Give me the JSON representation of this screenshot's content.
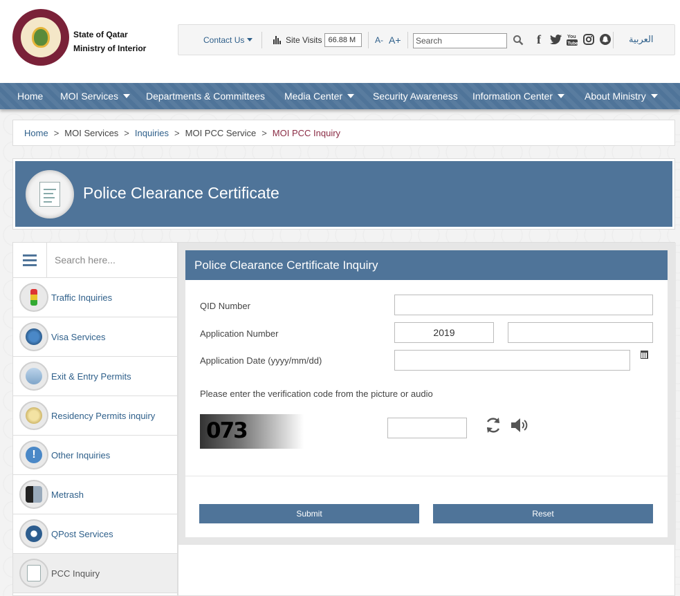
{
  "org": {
    "line1": "State of Qatar",
    "line2": "Ministry of Interior"
  },
  "topbar": {
    "contact_label": "Contact Us",
    "site_visits_label": "Site Visits",
    "site_visits_value": "66.88 M",
    "font_smaller": "A-",
    "font_larger": "A+",
    "search_placeholder": "Search",
    "social_icons": [
      "facebook-icon",
      "twitter-icon",
      "youtube-icon",
      "instagram-icon",
      "snapchat-icon"
    ],
    "language": "العربية"
  },
  "nav": {
    "items": [
      {
        "label": "Home"
      },
      {
        "label": "MOI Services"
      },
      {
        "label": "Departments & Committees"
      },
      {
        "label": "Media Center"
      },
      {
        "label": "Security Awareness"
      },
      {
        "label": "Information Center"
      },
      {
        "label": "About Ministry"
      }
    ]
  },
  "breadcrumb": {
    "items": [
      "Home",
      "MOI Services",
      "Inquiries",
      "MOI PCC Service",
      "MOI PCC Inquiry"
    ],
    "separator": ">"
  },
  "banner": {
    "title": "Police Clearance Certificate"
  },
  "sidebar": {
    "search_placeholder": "Search here...",
    "items": [
      {
        "label": "Traffic Inquiries"
      },
      {
        "label": "Visa Services"
      },
      {
        "label": "Exit & Entry Permits"
      },
      {
        "label": "Residency Permits inquiry"
      },
      {
        "label": "Other Inquiries"
      },
      {
        "label": "Metrash"
      },
      {
        "label": "QPost Services"
      },
      {
        "label": "PCC Inquiry"
      }
    ]
  },
  "form": {
    "title": "Police Clearance Certificate Inquiry",
    "qid_label": "QID Number",
    "qid_value": "",
    "app_number_label": "Application Number",
    "app_year_value": "2019",
    "app_number_value": "",
    "app_date_label": "Application Date (yyyy/mm/dd)",
    "app_date_value": "",
    "verification_text": "Please enter the verification code from the picture or audio",
    "captcha_text": "073",
    "captcha_value": "",
    "submit_label": "Submit",
    "reset_label": "Reset"
  },
  "colors": {
    "primary": "#4f7499",
    "link": "#2e5f8a",
    "breadcrumb_current": "#8a2b44",
    "logo": "#7a2138"
  }
}
